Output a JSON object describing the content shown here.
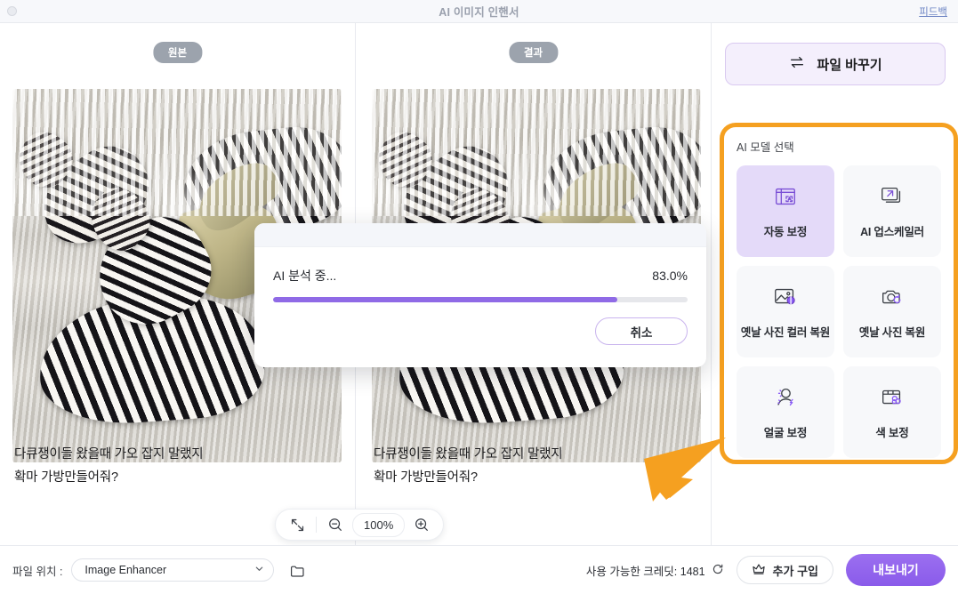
{
  "titlebar": {
    "title": "AI 이미지 인핸서",
    "feedback_label": "피드백"
  },
  "workspace": {
    "panes": [
      {
        "badge": "원본",
        "caption_line1": "다큐쟁이들 왔을때 가오 잡지 말랬지",
        "caption_line2": "확마 가방만들어줘?"
      },
      {
        "badge": "결과",
        "caption_line1": "다큐쟁이들 왔을때 가오 잡지 말랬지",
        "caption_line2": "확마 가방만들어줘?"
      }
    ],
    "zoom_toolbar": {
      "fit_icon": "fit-screen-icon",
      "zoom_out_icon": "zoom-out-icon",
      "level": "100%",
      "zoom_in_icon": "zoom-in-icon"
    }
  },
  "sidebar": {
    "swap_file_label": "파일 바꾸기",
    "swap_file_icon": "swap-arrows-icon",
    "model_section_title": "AI 모델 선택",
    "highlight_color": "#f5a020",
    "models": [
      {
        "label": "자동 보정",
        "icon": "auto-enhance-icon",
        "selected": true
      },
      {
        "label": "AI 업스케일러",
        "icon": "upscale-icon",
        "selected": false
      },
      {
        "label": "옛날 사진 컬러 복원",
        "icon": "colorize-photo-icon",
        "selected": false
      },
      {
        "label": "옛날 사진 복원",
        "icon": "restore-photo-icon",
        "selected": false
      },
      {
        "label": "얼굴 보정",
        "icon": "face-retouch-icon",
        "selected": false
      },
      {
        "label": "색 보정",
        "icon": "color-correct-icon",
        "selected": false
      }
    ]
  },
  "modal": {
    "status_text": "AI 분석 중...",
    "percent_text": "83.0%",
    "percent_value": 83.0,
    "cancel_label": "취소",
    "bar_color": "#8f6ae6"
  },
  "bottombar": {
    "path_label": "파일 위치 :",
    "path_value": "Image Enhancer",
    "folder_icon": "folder-icon",
    "credits_text": "사용 가능한 크레딧: 1481",
    "refresh_icon": "refresh-icon",
    "buy_label": "추가 구입",
    "buy_icon": "crown-icon",
    "export_label": "내보내기"
  }
}
